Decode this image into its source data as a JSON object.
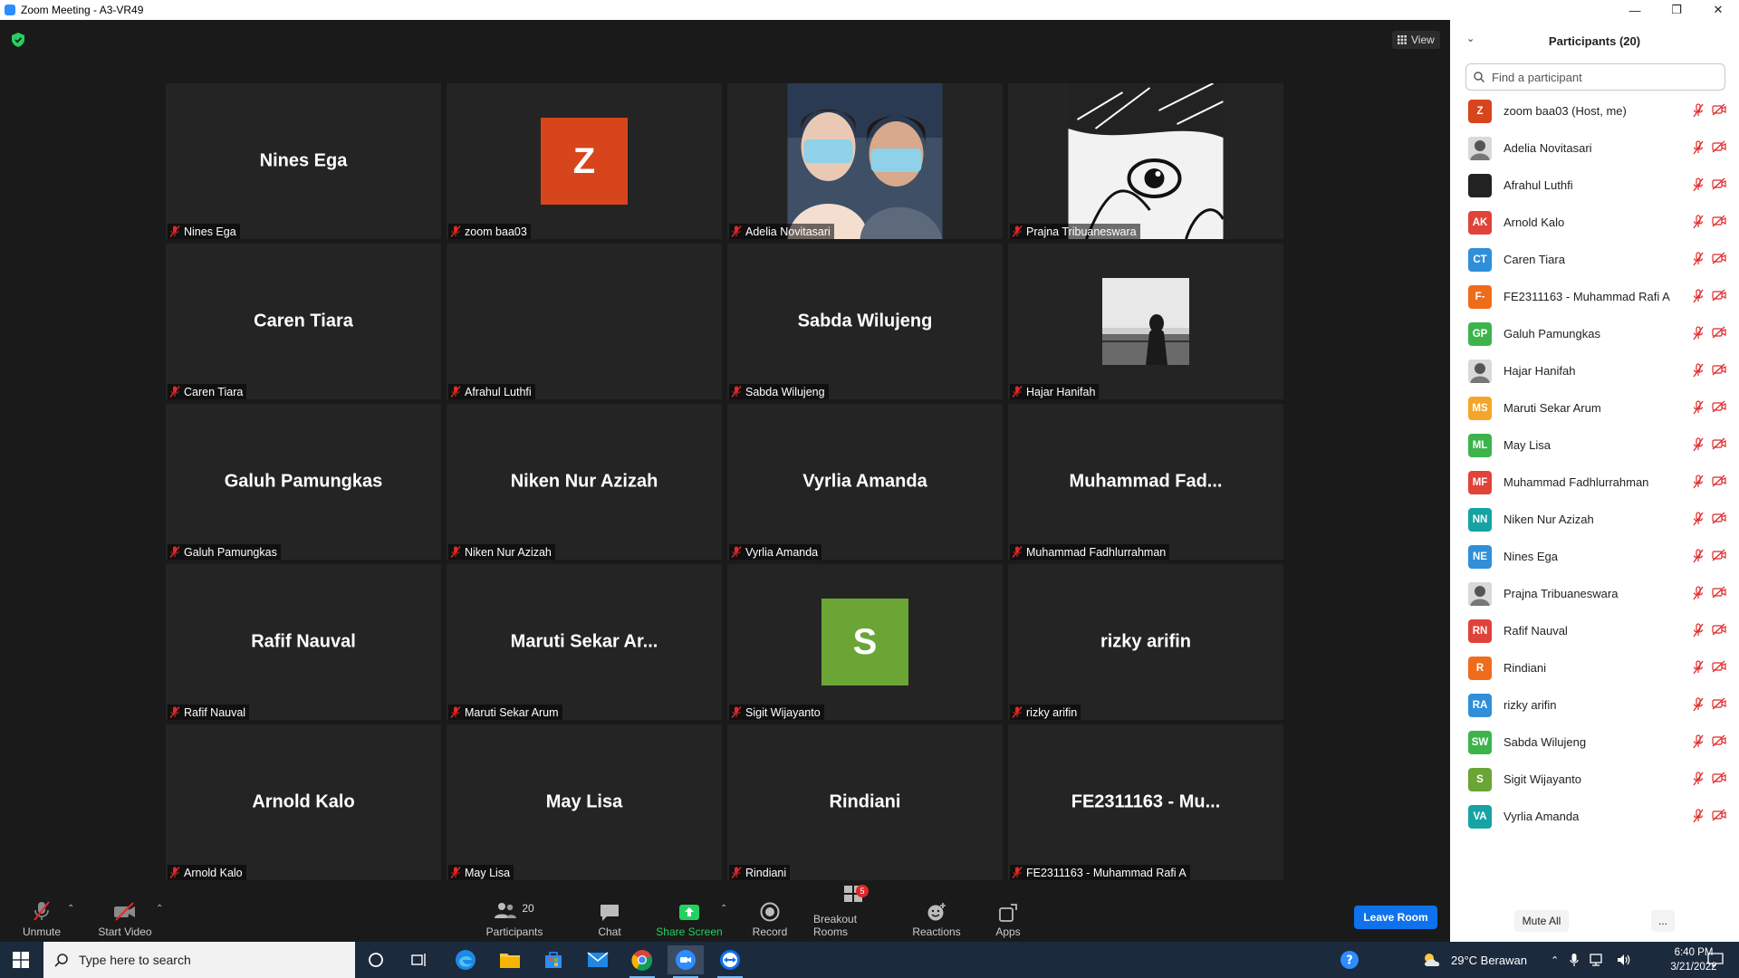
{
  "window": {
    "title": "Zoom Meeting - A3-VR49",
    "controls": [
      "minimize",
      "restore",
      "close"
    ]
  },
  "meeting": {
    "view_label": "View",
    "tiles": [
      {
        "display": "Nines Ega",
        "label": "Nines Ega",
        "kind": "name"
      },
      {
        "display": "Z",
        "label": "zoom baa03",
        "kind": "avatar",
        "color": "#d7451c"
      },
      {
        "display": "",
        "label": "Adelia Novitasari",
        "kind": "photo"
      },
      {
        "display": "",
        "label": "Prajna Tribuaneswara",
        "kind": "manga"
      },
      {
        "display": "Caren Tiara",
        "label": "Caren Tiara",
        "kind": "name"
      },
      {
        "display": "",
        "label": "Afrahul Luthfi",
        "kind": "blank"
      },
      {
        "display": "Sabda Wilujeng",
        "label": "Sabda Wilujeng",
        "kind": "name"
      },
      {
        "display": "",
        "label": "Hajar Hanifah",
        "kind": "small-photo"
      },
      {
        "display": "Galuh Pamungkas",
        "label": "Galuh Pamungkas",
        "kind": "name"
      },
      {
        "display": "Niken Nur Azizah",
        "label": "Niken Nur Azizah",
        "kind": "name"
      },
      {
        "display": "Vyrlia Amanda",
        "label": "Vyrlia Amanda",
        "kind": "name"
      },
      {
        "display": "Muhammad  Fad...",
        "label": "Muhammad Fadhlurrahman",
        "kind": "name"
      },
      {
        "display": "Rafif Nauval",
        "label": "Rafif Nauval",
        "kind": "name"
      },
      {
        "display": "Maruti  Sekar  Ar...",
        "label": "Maruti Sekar Arum",
        "kind": "name"
      },
      {
        "display": "S",
        "label": "Sigit Wijayanto",
        "kind": "avatar",
        "color": "#6aa536"
      },
      {
        "display": "rizky arifin",
        "label": "rizky arifin",
        "kind": "name"
      },
      {
        "display": "Arnold Kalo",
        "label": "Arnold Kalo",
        "kind": "name"
      },
      {
        "display": "May Lisa",
        "label": "May Lisa",
        "kind": "name"
      },
      {
        "display": "Rindiani",
        "label": "Rindiani",
        "kind": "name"
      },
      {
        "display": "FE2311163  -  Mu...",
        "label": "FE2311163 - Muhammad Rafi A",
        "kind": "name"
      }
    ]
  },
  "toolbar": {
    "unmute": "Unmute",
    "start_video": "Start Video",
    "participants": "Participants",
    "participants_count": "20",
    "chat": "Chat",
    "share_screen": "Share Screen",
    "record": "Record",
    "breakout_rooms": "Breakout Rooms",
    "breakout_badge": "5",
    "reactions": "Reactions",
    "apps": "Apps",
    "leave_room": "Leave Room",
    "share_color": "#23d160"
  },
  "panel": {
    "title": "Participants (20)",
    "search_placeholder": "Find a participant",
    "mute_all": "Mute All",
    "more": "...",
    "participants": [
      {
        "initials": "Z",
        "name": "zoom baa03 (Host, me)",
        "color": "#d7451c"
      },
      {
        "initials": "",
        "name": "Adelia Novitasari",
        "color": "#8a7a6a",
        "photo": true
      },
      {
        "initials": "",
        "name": "Afrahul Luthfi",
        "color": "#222222"
      },
      {
        "initials": "AK",
        "name": "Arnold Kalo",
        "color": "#e0433a"
      },
      {
        "initials": "CT",
        "name": "Caren Tiara",
        "color": "#2f8fd8"
      },
      {
        "initials": "F-",
        "name": "FE2311163 - Muhammad Rafi A",
        "color": "#ef6c1a"
      },
      {
        "initials": "GP",
        "name": "Galuh Pamungkas",
        "color": "#3cb44b"
      },
      {
        "initials": "",
        "name": "Hajar Hanifah",
        "color": "#9a9a9a",
        "photo": true
      },
      {
        "initials": "MS",
        "name": "Maruti Sekar Arum",
        "color": "#f4a62a"
      },
      {
        "initials": "ML",
        "name": "May Lisa",
        "color": "#3cb44b"
      },
      {
        "initials": "MF",
        "name": "Muhammad Fadhlurrahman",
        "color": "#e0433a"
      },
      {
        "initials": "NN",
        "name": "Niken Nur Azizah",
        "color": "#16a3a3"
      },
      {
        "initials": "NE",
        "name": "Nines Ega",
        "color": "#2f8fd8"
      },
      {
        "initials": "",
        "name": "Prajna Tribuaneswara",
        "color": "#555555",
        "photo": true
      },
      {
        "initials": "RN",
        "name": "Rafif Nauval",
        "color": "#e0433a"
      },
      {
        "initials": "R",
        "name": "Rindiani",
        "color": "#ef6c1a"
      },
      {
        "initials": "RA",
        "name": "rizky arifin",
        "color": "#2f8fd8"
      },
      {
        "initials": "SW",
        "name": "Sabda Wilujeng",
        "color": "#3cb44b"
      },
      {
        "initials": "S",
        "name": "Sigit Wijayanto",
        "color": "#6aa536"
      },
      {
        "initials": "VA",
        "name": "Vyrlia Amanda",
        "color": "#16a3a3"
      }
    ]
  },
  "taskbar": {
    "search_placeholder": "Type here to search",
    "weather": "29°C  Berawan",
    "time": "6:40 PM",
    "date": "3/21/2022"
  }
}
